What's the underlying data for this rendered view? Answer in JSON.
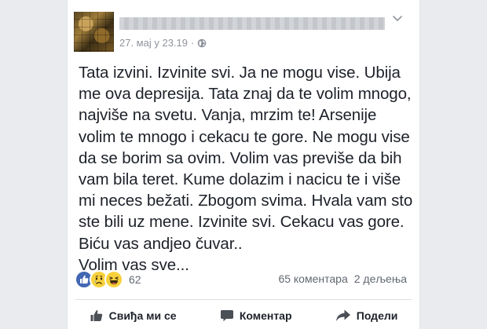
{
  "post": {
    "timestamp": "27. мај у 23.19",
    "separator": "·",
    "privacy_icon": "globe-icon",
    "text_lines": [
      "Tata izvini. Izvinite svi. Ja ne mogu vise. Ubija",
      "me ova depresija. Tata znaj da te volim mnogo,",
      "najviše na svetu. Vanja, mrzim te! Arsenije",
      "volim te mnogo i cekacu te gore. Ne mogu vise",
      "da se borim sa ovim. Volim vas previše da bih",
      "vam bila teret. Kume dolazim i nacicu te i više",
      "mi neces bežati. Zbogom svima. Hvala vam sto",
      "ste bili uz mene. Izvinite svi. Cekacu vas gore.",
      "Biću vas andjeo čuvar..",
      "Volim vas sve..."
    ]
  },
  "reactions": {
    "icons": [
      "like-icon",
      "sad-icon",
      "haha-icon"
    ],
    "count": "62",
    "comments": "65 коментара",
    "shares": "2 дељења"
  },
  "actions": {
    "like_label": "Свиђа ми се",
    "comment_label": "Коментар",
    "share_label": "Подели"
  },
  "colors": {
    "background": "#e9ebee",
    "card": "#ffffff",
    "like_blue": "#4267b2",
    "secondary_text": "#90949c"
  }
}
